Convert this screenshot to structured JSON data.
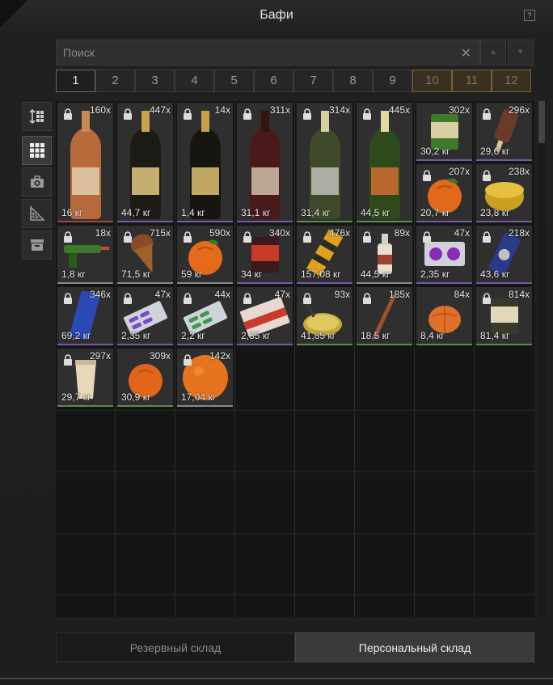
{
  "window": {
    "title": "Бафи",
    "help_label": "?"
  },
  "search": {
    "placeholder": "Поиск",
    "value": "",
    "clear_icon": "close-icon"
  },
  "pages": [
    {
      "label": "1",
      "state": "active"
    },
    {
      "label": "2",
      "state": "normal"
    },
    {
      "label": "3",
      "state": "normal"
    },
    {
      "label": "4",
      "state": "normal"
    },
    {
      "label": "5",
      "state": "normal"
    },
    {
      "label": "6",
      "state": "normal"
    },
    {
      "label": "7",
      "state": "normal"
    },
    {
      "label": "8",
      "state": "normal"
    },
    {
      "label": "9",
      "state": "normal"
    },
    {
      "label": "10",
      "state": "locked"
    },
    {
      "label": "11",
      "state": "locked"
    },
    {
      "label": "12",
      "state": "locked"
    }
  ],
  "sidebar": [
    {
      "icon": "sort-icon",
      "active": false
    },
    {
      "icon": "grid-view-icon",
      "active": true
    },
    {
      "icon": "medkit-icon",
      "active": false
    },
    {
      "icon": "ruler-triangle-icon",
      "active": false
    },
    {
      "icon": "archive-box-icon",
      "active": false
    }
  ],
  "items": [
    {
      "name": "molotov-bottle",
      "count": "160x",
      "weight": "16 кг",
      "rarity": "red",
      "locked": true,
      "col": 0,
      "row": 0,
      "rows": 2
    },
    {
      "name": "champagne-bottle-dark",
      "count": "447x",
      "weight": "44,7 кг",
      "rarity": "purple",
      "locked": true,
      "col": 1,
      "row": 0,
      "rows": 2
    },
    {
      "name": "champagne-bottle-gold",
      "count": "14x",
      "weight": "1,4 кг",
      "rarity": "purple",
      "locked": true,
      "col": 2,
      "row": 0,
      "rows": 2
    },
    {
      "name": "wine-bottle",
      "count": "311x",
      "weight": "31,1 кг",
      "rarity": "purple",
      "locked": true,
      "col": 3,
      "row": 0,
      "rows": 2
    },
    {
      "name": "champagne-bottle-silver",
      "count": "314x",
      "weight": "31,4 кг",
      "rarity": "green",
      "locked": true,
      "col": 4,
      "row": 0,
      "rows": 2
    },
    {
      "name": "champagne-bottle-label",
      "count": "445x",
      "weight": "44,5 кг",
      "rarity": "green",
      "locked": true,
      "col": 5,
      "row": 0,
      "rows": 2
    },
    {
      "name": "green-can",
      "count": "302x",
      "weight": "30,2 кг",
      "rarity": "purple",
      "locked": false,
      "col": 6,
      "row": 0,
      "rows": 1
    },
    {
      "name": "ice-cream-bar",
      "count": "296x",
      "weight": "29,6 кг",
      "rarity": "purple",
      "locked": true,
      "col": 7,
      "row": 0,
      "rows": 1
    },
    {
      "name": "tangerine-leaf",
      "count": "207x",
      "weight": "20,7 кг",
      "rarity": "purple",
      "locked": true,
      "col": 6,
      "row": 1,
      "rows": 1
    },
    {
      "name": "gold-tin",
      "count": "238x",
      "weight": "23,8 кг",
      "rarity": "purple",
      "locked": true,
      "col": 7,
      "row": 1,
      "rows": 1
    },
    {
      "name": "glue-gun",
      "count": "18x",
      "weight": "1,8 кг",
      "rarity": "white",
      "locked": true,
      "col": 0,
      "row": 2,
      "rows": 1
    },
    {
      "name": "chocolate-cone",
      "count": "715x",
      "weight": "71,5 кг",
      "rarity": "white",
      "locked": true,
      "col": 1,
      "row": 2,
      "rows": 1
    },
    {
      "name": "orange",
      "count": "590x",
      "weight": "59 кг",
      "rarity": "white",
      "locked": true,
      "col": 2,
      "row": 2,
      "rows": 1
    },
    {
      "name": "sauce-can",
      "count": "340x",
      "weight": "34 кг",
      "rarity": "purple",
      "locked": true,
      "col": 3,
      "row": 2,
      "rows": 1
    },
    {
      "name": "firecracker",
      "count": "476x",
      "weight": "157,08 кг",
      "rarity": "purple",
      "locked": true,
      "col": 4,
      "row": 2,
      "rows": 1
    },
    {
      "name": "small-bottle",
      "count": "89x",
      "weight": "44,5 кг",
      "rarity": "white",
      "locked": true,
      "col": 5,
      "row": 2,
      "rows": 1
    },
    {
      "name": "pill-blister",
      "count": "47x",
      "weight": "2,35 кг",
      "rarity": "purple",
      "locked": true,
      "col": 6,
      "row": 2,
      "rows": 1
    },
    {
      "name": "hero-spray",
      "count": "218x",
      "weight": "43,6 кг",
      "rarity": "purple",
      "locked": true,
      "col": 7,
      "row": 2,
      "rows": 1
    },
    {
      "name": "blue-can",
      "count": "346x",
      "weight": "69,2 кг",
      "rarity": "purple",
      "locked": true,
      "col": 0,
      "row": 3,
      "rows": 1
    },
    {
      "name": "pill-pack-purple",
      "count": "47x",
      "weight": "2,35 кг",
      "rarity": "purple",
      "locked": true,
      "col": 1,
      "row": 3,
      "rows": 1
    },
    {
      "name": "pill-pack-green",
      "count": "44x",
      "weight": "2,2 кг",
      "rarity": "purple",
      "locked": true,
      "col": 2,
      "row": 3,
      "rows": 1
    },
    {
      "name": "pill-box-red",
      "count": "47x",
      "weight": "2,35 кг",
      "rarity": "purple",
      "locked": true,
      "col": 3,
      "row": 3,
      "rows": 1
    },
    {
      "name": "frying-pan",
      "count": "93x",
      "weight": "41,85 кг",
      "rarity": "green",
      "locked": true,
      "col": 4,
      "row": 3,
      "rows": 1
    },
    {
      "name": "stick",
      "count": "185x",
      "weight": "18,5 кг",
      "rarity": "green",
      "locked": true,
      "col": 5,
      "row": 3,
      "rows": 1
    },
    {
      "name": "peeled-orange",
      "count": "84x",
      "weight": "8,4 кг",
      "rarity": "green",
      "locked": false,
      "col": 6,
      "row": 3,
      "rows": 1
    },
    {
      "name": "beans-can",
      "count": "814x",
      "weight": "81,4 кг",
      "rarity": "green",
      "locked": true,
      "col": 7,
      "row": 3,
      "rows": 1
    },
    {
      "name": "paper-cup",
      "count": "297x",
      "weight": "29,7 кг",
      "rarity": "green",
      "locked": true,
      "col": 0,
      "row": 4,
      "rows": 1
    },
    {
      "name": "tangerine",
      "count": "309x",
      "weight": "30,9 кг",
      "rarity": "green",
      "locked": false,
      "col": 1,
      "row": 4,
      "rows": 1
    },
    {
      "name": "big-orange",
      "count": "142x",
      "weight": "17,04 кг",
      "rarity": "white",
      "locked": true,
      "col": 2,
      "row": 4,
      "rows": 1
    }
  ],
  "tabs": [
    {
      "label": "Резервный склад",
      "active": false
    },
    {
      "label": "Персональный склад",
      "active": true
    }
  ],
  "colors": {
    "rarity_purple": "#7a58a8",
    "rarity_green": "#5b8c4a",
    "rarity_red": "#a04545",
    "rarity_white": "#8a8a8a",
    "locked_page": "#8e7440"
  }
}
